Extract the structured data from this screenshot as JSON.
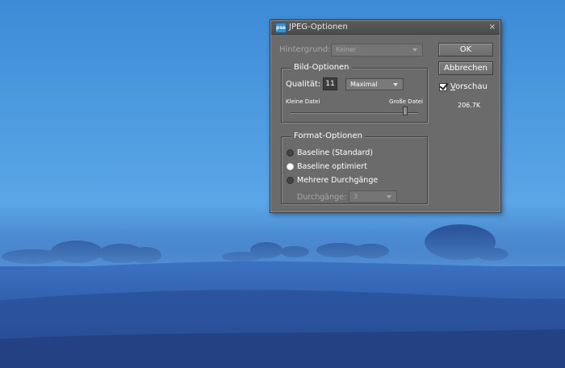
{
  "dialog": {
    "title": "JPEG-Optionen",
    "app_icon_label": "pse",
    "close_glyph": "×",
    "background": {
      "label": "Hintergrund:",
      "value": "Keiner"
    },
    "image_options": {
      "group_title": "Bild-Optionen",
      "quality_label": "Qualität:",
      "quality_value": "11",
      "quality_preset": "Maximal",
      "small_file_label": "Kleine Datei",
      "large_file_label": "Große Datei",
      "quality_level_of_12": 11
    },
    "format_options": {
      "group_title": "Format-Optionen",
      "options": [
        {
          "label": "Baseline (Standard)",
          "selected": false
        },
        {
          "label": "Baseline optimiert",
          "selected": true
        },
        {
          "label": "Mehrere Durchgänge",
          "selected": false
        }
      ],
      "passes_label": "Durchgänge:",
      "passes_value": "3"
    },
    "buttons": {
      "ok": "OK",
      "cancel": "Abbrechen"
    },
    "preview": {
      "label_first": "V",
      "label_rest": "orschau",
      "checked": true,
      "file_size": "206.7K"
    }
  },
  "colors": {
    "dialog_bg": "#6b6b6b",
    "sky": "#4d9ae0",
    "field": "#2e5aa8"
  }
}
